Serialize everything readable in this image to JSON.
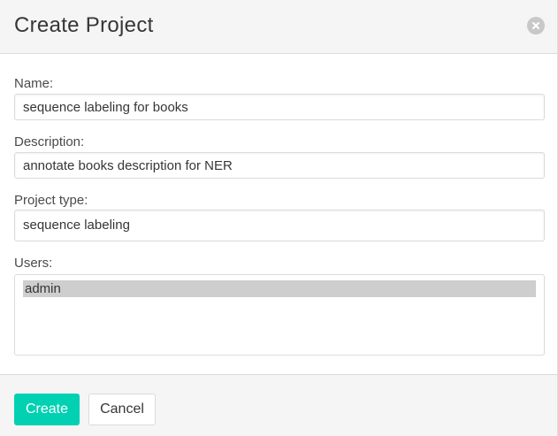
{
  "dialog": {
    "title": "Create Project",
    "close_icon": "close-circle-icon"
  },
  "form": {
    "name": {
      "label": "Name:",
      "value": "sequence labeling for books"
    },
    "description": {
      "label": "Description:",
      "value": "annotate books description for NER"
    },
    "project_type": {
      "label": "Project type:",
      "value": "sequence labeling"
    },
    "users": {
      "label": "Users:",
      "options": [
        {
          "label": "admin",
          "selected": true
        }
      ]
    }
  },
  "footer": {
    "create_label": "Create",
    "cancel_label": "Cancel"
  },
  "colors": {
    "primary": "#00d1b2",
    "header_bg": "#f5f5f5",
    "border": "#dbdbdb",
    "selected_option": "#cecece"
  }
}
